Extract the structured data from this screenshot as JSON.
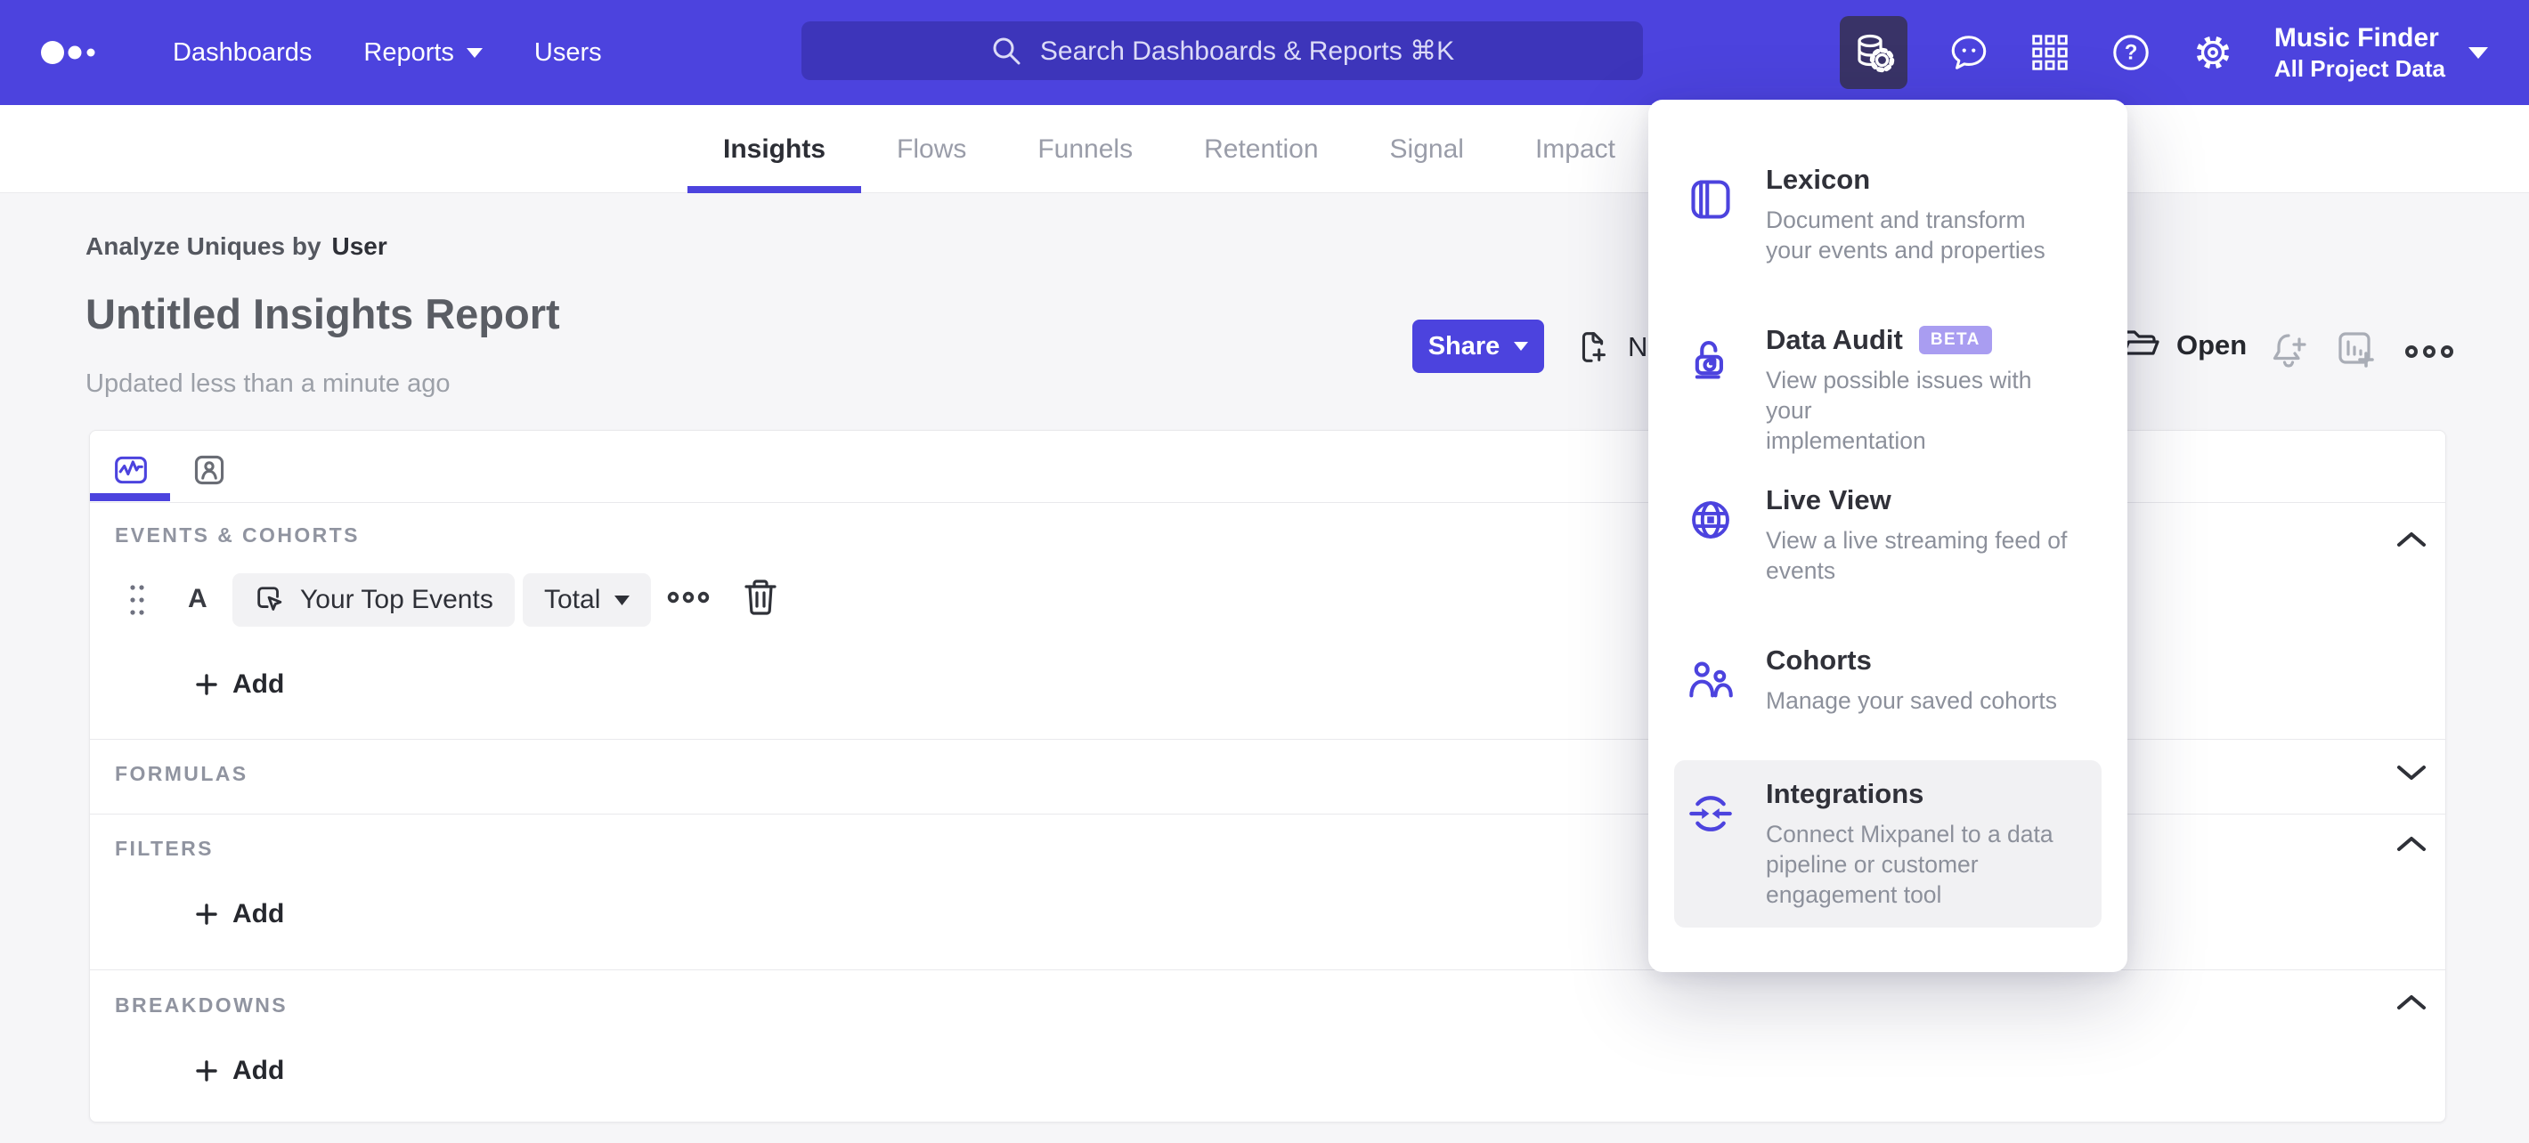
{
  "nav": {
    "items": [
      "Dashboards",
      "Reports",
      "Users"
    ],
    "search": {
      "placeholder": "Search Dashboards & Reports ⌘K"
    },
    "project": {
      "name": "Music Finder",
      "scope": "All Project Data"
    }
  },
  "report_tabs": {
    "items": [
      "Insights",
      "Flows",
      "Funnels",
      "Retention",
      "Signal",
      "Impact"
    ],
    "active": "Insights"
  },
  "header": {
    "breadcrumb_prefix": "Analyze Uniques by",
    "breadcrumb_value": "User",
    "title": "Untitled Insights Report",
    "updated": "Updated less than a minute ago",
    "share_label": "Share",
    "new_label": "New",
    "open_label": "Open"
  },
  "builder": {
    "events": {
      "label": "EVENTS & COHORTS",
      "row": {
        "letter": "A",
        "event": "Your Top Events",
        "aggregation": "Total"
      },
      "add_label": "Add"
    },
    "formulas": {
      "label": "FORMULAS"
    },
    "filters": {
      "label": "FILTERS",
      "add_label": "Add"
    },
    "breakdowns": {
      "label": "BREAKDOWNS",
      "add_label": "Add"
    }
  },
  "menu": {
    "items": [
      {
        "icon": "lexicon-book-icon",
        "title": "Lexicon",
        "description": "Document and transform\nyour events and properties"
      },
      {
        "icon": "data-audit-lock-icon",
        "title": "Data Audit",
        "badge": "BETA",
        "description": "View possible issues with your\nimplementation"
      },
      {
        "icon": "live-view-globe-icon",
        "title": "Live View",
        "description": "View a live streaming feed of\nevents"
      },
      {
        "icon": "cohorts-people-icon",
        "title": "Cohorts",
        "description": "Manage your saved cohorts"
      },
      {
        "icon": "integrations-sync-icon",
        "title": "Integrations",
        "highlighted": true,
        "description": "Connect Mixpanel to a data\npipeline or customer\nengagement tool"
      }
    ]
  },
  "colors": {
    "nav_purple": "#4c43de",
    "nav_active_icon_bg": "#393367",
    "accent": "#4c43de",
    "beta_badge_bg": "#a99df1",
    "page_bg": "#f6f6f8",
    "menu_highlight_bg": "#f1f1f3",
    "text_dark": "#2e3037",
    "text_gray": "#8c909b",
    "section_label_gray": "#9094a0"
  },
  "icons": {
    "logo": "mixpanel-dots",
    "search": "magnifier",
    "data_management": "database-gear",
    "feedback": "chat-bubble",
    "apps": "grid-3x3",
    "help": "question-circle",
    "settings": "gear",
    "share_caret": "caret-down",
    "new": "file-plus",
    "open": "folder",
    "alerts": "bell-plus",
    "add_board": "chart-board-plus",
    "more": "ellipsis",
    "trash": "trash-can",
    "drag": "drag-handle-dots"
  }
}
